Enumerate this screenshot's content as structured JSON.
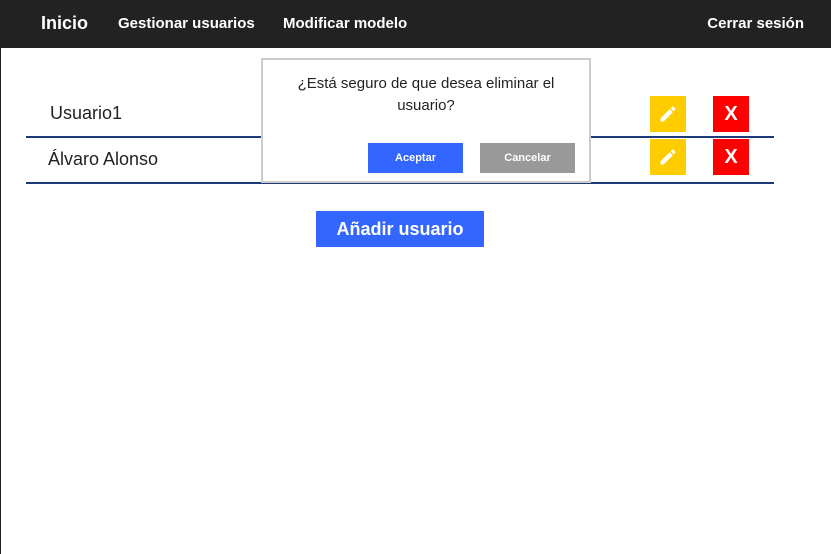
{
  "nav": {
    "brand": "Inicio",
    "links": [
      "Gestionar usuarios",
      "Modificar modelo"
    ],
    "logout": "Cerrar sesión"
  },
  "users": [
    {
      "name": "Usuario1"
    },
    {
      "name": "Álvaro Alonso"
    }
  ],
  "actions": {
    "delete_label": "X",
    "edit_icon": "pencil-icon"
  },
  "add_button": "Añadir usuario",
  "dialog": {
    "message": "¿Está seguro de que desea eliminar el usuario?",
    "accept": "Aceptar",
    "cancel": "Cancelar"
  },
  "colors": {
    "navbar": "#222222",
    "primary": "#3366ff",
    "edit": "#ffcc00",
    "delete": "#ff0000",
    "cancel": "#999999",
    "row_border": "#1f3a7a"
  }
}
